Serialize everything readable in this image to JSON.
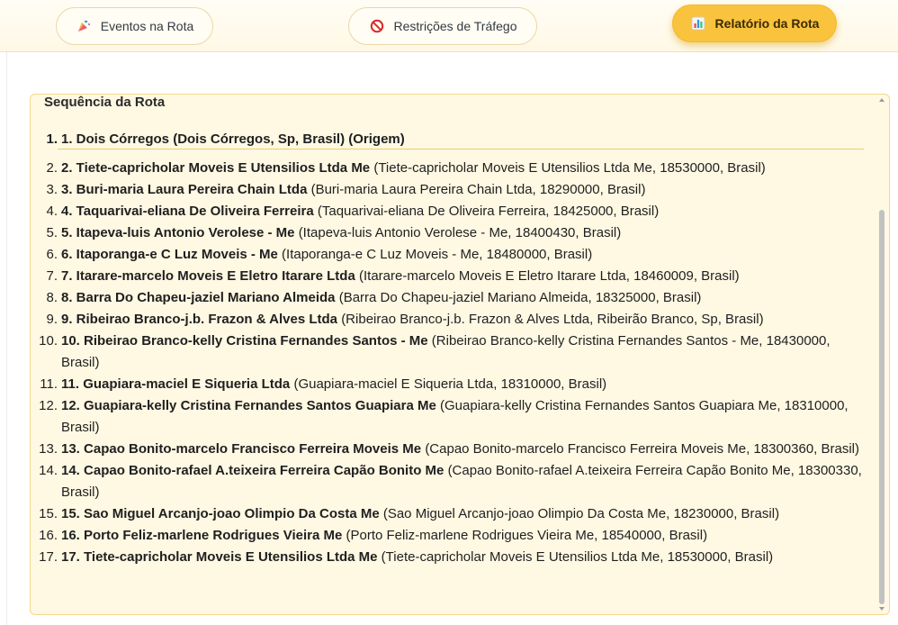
{
  "tabs": [
    {
      "label": "Eventos na Rota",
      "icon": "party-popper-icon",
      "active": false
    },
    {
      "label": "Restrições de Tráfego",
      "icon": "no-entry-icon",
      "active": false
    },
    {
      "label": "Relatório da Rota",
      "icon": "bar-chart-icon",
      "active": true
    }
  ],
  "panel": {
    "title": "Sequência da Rota",
    "origin": {
      "num": "1.",
      "text": "1. Dois Córregos (Dois Córregos, Sp, Brasil) (Origem)"
    },
    "stops": [
      {
        "num": "2.",
        "name": "2. Tiete-capricholar Moveis E Utensilios Ltda Me",
        "detail": "(Tiete-capricholar Moveis E Utensilios Ltda Me, 18530000, Brasil)"
      },
      {
        "num": "3.",
        "name": "3. Buri-maria Laura Pereira Chain Ltda",
        "detail": "(Buri-maria Laura Pereira Chain Ltda, 18290000, Brasil)"
      },
      {
        "num": "4.",
        "name": "4. Taquarivai-eliana De Oliveira Ferreira",
        "detail": "(Taquarivai-eliana De Oliveira Ferreira, 18425000, Brasil)"
      },
      {
        "num": "5.",
        "name": "5. Itapeva-luis Antonio Verolese - Me",
        "detail": "(Itapeva-luis Antonio Verolese - Me, 18400430, Brasil)"
      },
      {
        "num": "6.",
        "name": "6. Itaporanga-e C Luz Moveis - Me",
        "detail": "(Itaporanga-e C Luz Moveis - Me, 18480000, Brasil)"
      },
      {
        "num": "7.",
        "name": "7. Itarare-marcelo Moveis E Eletro Itarare Ltda",
        "detail": "(Itarare-marcelo Moveis E Eletro Itarare Ltda, 18460009, Brasil)"
      },
      {
        "num": "8.",
        "name": "8. Barra Do Chapeu-jaziel Mariano Almeida",
        "detail": "(Barra Do Chapeu-jaziel Mariano Almeida, 18325000, Brasil)"
      },
      {
        "num": "9.",
        "name": "9. Ribeirao Branco-j.b. Frazon & Alves Ltda",
        "detail": "(Ribeirao Branco-j.b. Frazon & Alves Ltda, Ribeirão Branco, Sp, Brasil)"
      },
      {
        "num": "10.",
        "name": "10. Ribeirao Branco-kelly Cristina Fernandes Santos - Me",
        "detail": "(Ribeirao Branco-kelly Cristina Fernandes Santos - Me, 18430000, Brasil)"
      },
      {
        "num": "11.",
        "name": "11. Guapiara-maciel E Siqueria Ltda",
        "detail": "(Guapiara-maciel E Siqueria Ltda, 18310000, Brasil)"
      },
      {
        "num": "12.",
        "name": "12. Guapiara-kelly Cristina Fernandes Santos Guapiara Me",
        "detail": "(Guapiara-kelly Cristina Fernandes Santos Guapiara Me, 18310000, Brasil)"
      },
      {
        "num": "13.",
        "name": "13. Capao Bonito-marcelo Francisco Ferreira Moveis Me",
        "detail": "(Capao Bonito-marcelo Francisco Ferreira Moveis Me, 18300360, Brasil)"
      },
      {
        "num": "14.",
        "name": "14. Capao Bonito-rafael A.teixeira Ferreira Capão Bonito Me",
        "detail": "(Capao Bonito-rafael A.teixeira Ferreira Capão Bonito Me, 18300330, Brasil)"
      },
      {
        "num": "15.",
        "name": "15. Sao Miguel Arcanjo-joao Olimpio Da Costa Me",
        "detail": "(Sao Miguel Arcanjo-joao Olimpio Da Costa Me, 18230000, Brasil)"
      },
      {
        "num": "16.",
        "name": "16. Porto Feliz-marlene Rodrigues Vieira Me",
        "detail": "(Porto Feliz-marlene Rodrigues Vieira Me, 18540000, Brasil)"
      },
      {
        "num": "17.",
        "name": "17. Tiete-capricholar Moveis E Utensilios Ltda Me",
        "detail": "(Tiete-capricholar Moveis E Utensilios Ltda Me, 18530000, Brasil)"
      }
    ]
  }
}
